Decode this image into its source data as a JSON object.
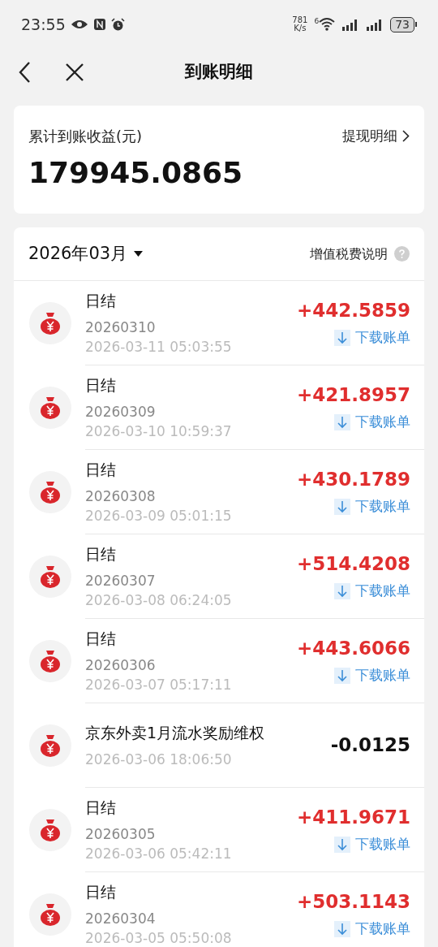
{
  "status_bar": {
    "time": "23:55",
    "speed_value": "781",
    "speed_unit": "K/s",
    "wifi_badge": "6",
    "battery": "73"
  },
  "header": {
    "title": "到账明细"
  },
  "summary": {
    "label": "累计到账收益(元)",
    "amount": "179945.0865",
    "link": "提现明细"
  },
  "month_bar": {
    "month": "2026年03月",
    "tax_note": "增值税费说明"
  },
  "rows": [
    {
      "kind": "settlement",
      "title": "日结",
      "sub": "20260310",
      "time": "2026-03-11 05:03:55",
      "amount": "+442.5859",
      "action": "下载账单"
    },
    {
      "kind": "settlement",
      "title": "日结",
      "sub": "20260309",
      "time": "2026-03-10 10:59:37",
      "amount": "+421.8957",
      "action": "下载账单"
    },
    {
      "kind": "settlement",
      "title": "日结",
      "sub": "20260308",
      "time": "2026-03-09 05:01:15",
      "amount": "+430.1789",
      "action": "下载账单"
    },
    {
      "kind": "settlement",
      "title": "日结",
      "sub": "20260307",
      "time": "2026-03-08 06:24:05",
      "amount": "+514.4208",
      "action": "下载账单"
    },
    {
      "kind": "settlement",
      "title": "日结",
      "sub": "20260306",
      "time": "2026-03-07 05:17:11",
      "amount": "+443.6066",
      "action": "下载账单"
    },
    {
      "kind": "deduction",
      "title": "京东外卖1月流水奖励维权",
      "time": "2026-03-06 18:06:50",
      "amount": "-0.0125"
    },
    {
      "kind": "settlement",
      "title": "日结",
      "sub": "20260305",
      "time": "2026-03-06 05:42:11",
      "amount": "+411.9671",
      "action": "下载账单"
    },
    {
      "kind": "settlement",
      "title": "日结",
      "sub": "20260304",
      "time": "2026-03-05 05:50:08",
      "amount": "+503.1143",
      "action": "下载账单"
    }
  ]
}
